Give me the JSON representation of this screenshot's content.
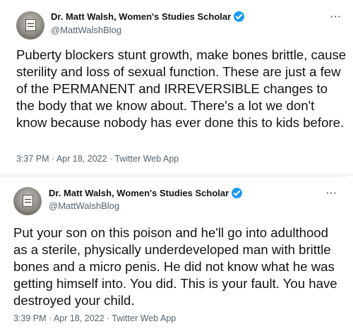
{
  "tweets": [
    {
      "author_name": "Dr. Matt Walsh, Women's Studies Scholar",
      "handle": "@MattWalshBlog",
      "more": "···",
      "text": "Puberty blockers stunt growth, make bones brittle, cause sterility and loss of sexual function. These are just a few of the PERMANENT and IRREVERSIBLE changes to the body that we know about. There's a lot we don't know because nobody has ever done this to kids before.",
      "meta": "3:37 PM · Apr 18, 2022 · Twitter Web App"
    },
    {
      "author_name": "Dr. Matt Walsh, Women's Studies Scholar",
      "handle": "@MattWalshBlog",
      "more": "···",
      "text": "Put your son on this poison and he'll go into adulthood as a sterile, physically underdeveloped man with brittle bones and a micro penis. He did not know what he was getting himself into. You did. This is your fault. You have destroyed your child.",
      "meta": "3:39 PM · Apr 18, 2022 · Twitter Web App"
    }
  ],
  "icons": {
    "verified": "verified-badge-icon",
    "more": "more-options-icon"
  },
  "colors": {
    "verified": "#1d9bf0",
    "text": "#0f1419",
    "secondary": "#536471"
  }
}
